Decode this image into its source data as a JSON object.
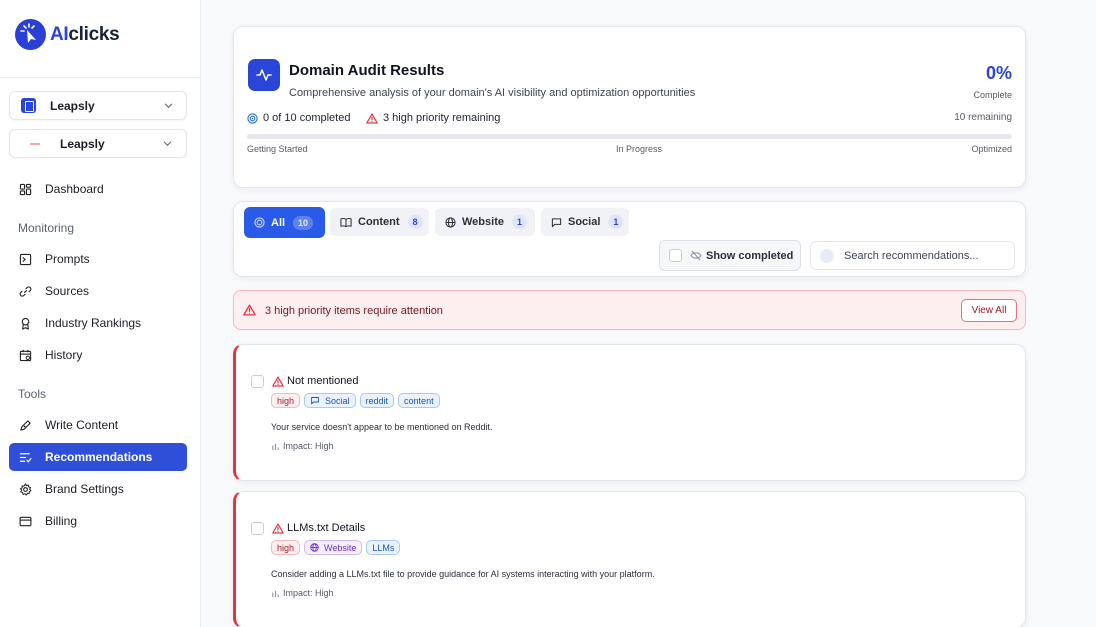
{
  "brand": {
    "name_prefix": "AI",
    "name_suffix": "clicks"
  },
  "workspace_selectors": [
    {
      "label": "Leapsly"
    },
    {
      "label": "Leapsly"
    }
  ],
  "sidebar": {
    "top_items": [
      {
        "label": "Dashboard",
        "icon": "dashboard-icon"
      }
    ],
    "monitoring_label": "Monitoring",
    "monitoring_items": [
      {
        "label": "Prompts",
        "icon": "terminal-icon"
      },
      {
        "label": "Sources",
        "icon": "link-icon"
      },
      {
        "label": "Industry Rankings",
        "icon": "award-icon"
      },
      {
        "label": "History",
        "icon": "calendar-icon"
      }
    ],
    "tools_label": "Tools",
    "tools_items": [
      {
        "label": "Write Content",
        "icon": "pen-icon"
      },
      {
        "label": "Recommendations",
        "icon": "list-check-icon",
        "active": true
      },
      {
        "label": "Brand Settings",
        "icon": "gear-icon"
      },
      {
        "label": "Billing",
        "icon": "card-icon"
      }
    ]
  },
  "audit": {
    "title": "Domain Audit Results",
    "subtitle": "Comprehensive analysis of your domain's AI visibility and optimization opportunities",
    "percent": "0%",
    "percent_label": "Complete",
    "progress_fraction": 0,
    "completed_text": "0 of 10 completed",
    "high_priority_text": "3 high priority remaining",
    "remaining_text": "10 remaining",
    "stage_labels": [
      "Getting Started",
      "In Progress",
      "Optimized"
    ]
  },
  "filters": {
    "tabs": [
      {
        "label": "All",
        "count": "10",
        "icon": "target-icon",
        "active": true
      },
      {
        "label": "Content",
        "count": "8",
        "icon": "book-icon"
      },
      {
        "label": "Website",
        "count": "1",
        "icon": "globe-icon"
      },
      {
        "label": "Social",
        "count": "1",
        "icon": "message-icon"
      }
    ],
    "show_completed_label": "Show completed",
    "search_placeholder": "Search recommendations..."
  },
  "alert": {
    "text": "3 high priority items require attention",
    "button_label": "View All"
  },
  "recommendations": [
    {
      "title": "Not mentioned",
      "priority": "high",
      "category": "Social",
      "tags": [
        "reddit",
        "content"
      ],
      "description": "Your service doesn't appear to be mentioned on Reddit.",
      "impact": "Impact: High"
    },
    {
      "title": "LLMs.txt Details",
      "priority": "high",
      "category": "Website",
      "tags": [
        "LLMs"
      ],
      "description": "Consider adding a LLMs.txt file to provide guidance for AI systems interacting with your platform.",
      "impact": "Impact: High"
    }
  ],
  "colors": {
    "accent": "#2a46d8",
    "danger": "#e5343f",
    "active_nav": "#2f4fd8"
  }
}
